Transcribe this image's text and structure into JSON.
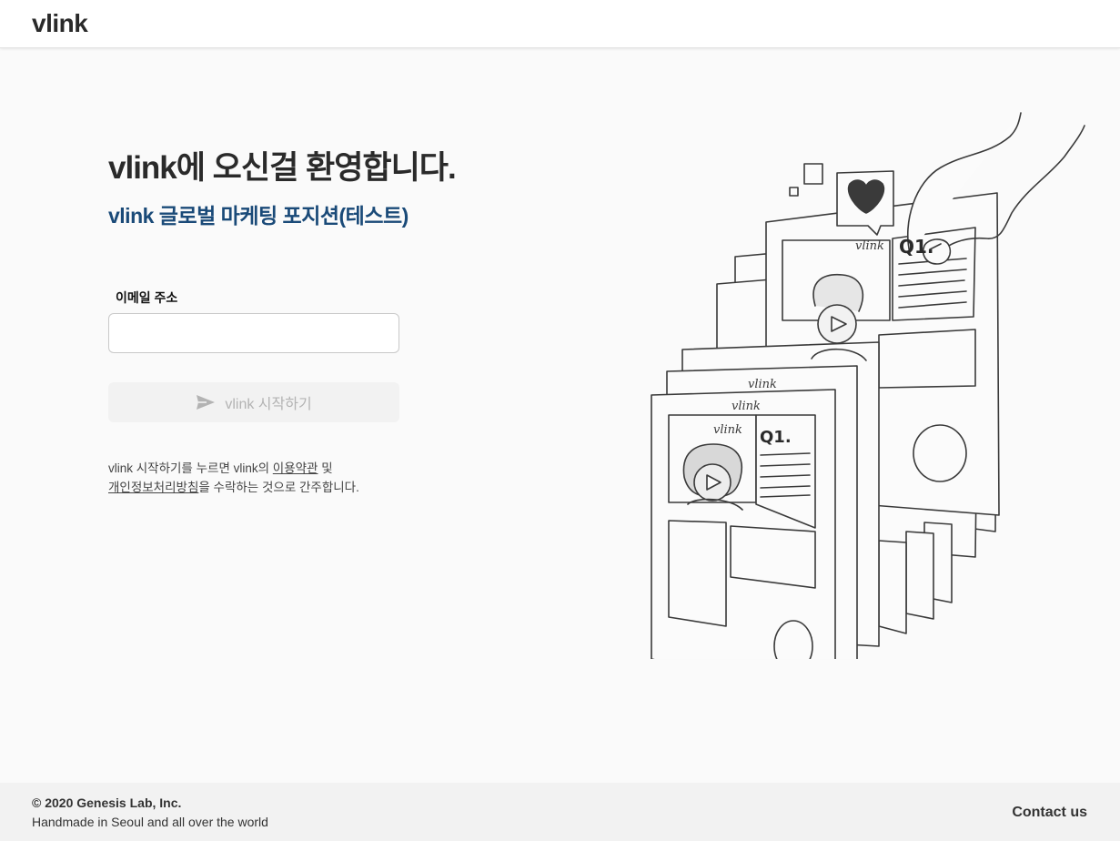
{
  "header": {
    "logo_text": "vlink"
  },
  "main": {
    "welcome_title": "vlink에 오신걸 환영합니다.",
    "position_title": "vlink 글로벌 마케팅 포지션(테스트)",
    "email_label": "이메일 주소",
    "email_value": "",
    "email_placeholder": "",
    "start_button_label": "vlink 시작하기",
    "start_button_icon": "send-icon",
    "terms": {
      "line1_prefix": "vlink 시작하기를 누르면 vlink의 ",
      "terms_link": "이용약관",
      "line1_suffix": " 및",
      "privacy_link": "개인정보처리방침",
      "line2_suffix": "을 수락하는 것으로 간주합니다."
    },
    "illustration": {
      "brand_small": "vlink",
      "question_label": "Q1."
    }
  },
  "footer": {
    "copyright": "© 2020 Genesis Lab, Inc.",
    "tagline": "Handmade in Seoul and all over the world",
    "contact_label": "Contact us"
  },
  "colors": {
    "accent_blue": "#1a4a78",
    "text_dark": "#2a2a2a",
    "button_disabled_bg": "#f2f2f2",
    "button_disabled_text": "#b3b3b3"
  }
}
